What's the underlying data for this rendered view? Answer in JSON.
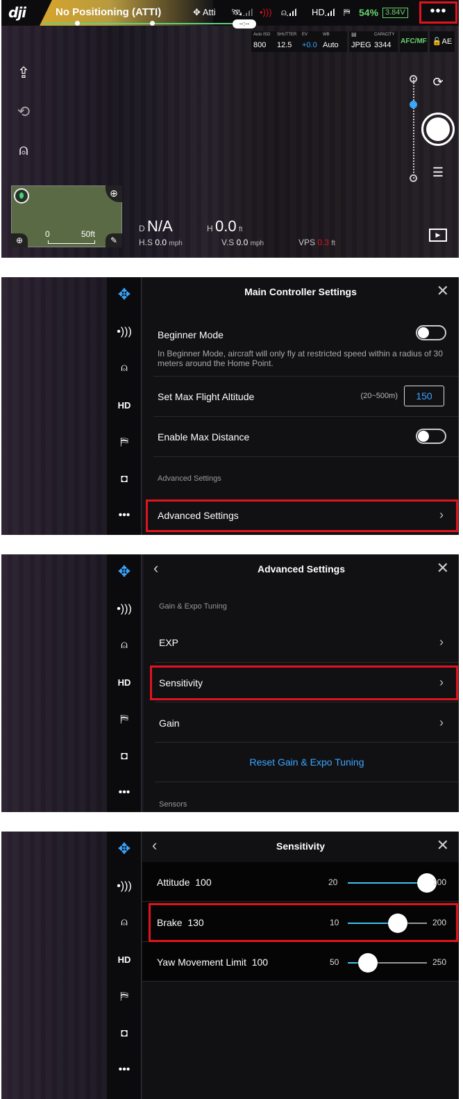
{
  "screen1": {
    "logo": "dji",
    "status": "No Positioning (ATTI)",
    "mode": "Atti",
    "hd_label": "HD",
    "battery_pct": "54%",
    "voltage": "3.84V",
    "time_pill": "--:--",
    "more_label": "•••",
    "camera": [
      {
        "label": "Auto ISO",
        "value": "800"
      },
      {
        "label": "SHUTTER",
        "value": "12.5"
      },
      {
        "label": "EV",
        "value": "+0.0"
      },
      {
        "label": "WB",
        "value": "Auto"
      },
      {
        "label": "",
        "value": "JPEG"
      },
      {
        "label": "CAPACITY",
        "value": "3344"
      }
    ],
    "afc_label": "AFC/MF",
    "ae_label": "AE",
    "map_scale_min": "0",
    "map_scale_max": "50ft",
    "telemetry": {
      "d_label": "D",
      "d_value": "N/A",
      "h_label": "H",
      "h_value": "0.0",
      "h_unit": "ft",
      "hs_label": "H.S",
      "hs_value": "0.0",
      "hs_unit": "mph",
      "vs_label": "V.S",
      "vs_value": "0.0",
      "vs_unit": "mph",
      "vps_label": "VPS",
      "vps_value": "0.3",
      "vps_unit": "ft"
    }
  },
  "sidebar": {
    "hd_label": "HD",
    "more_label": "•••"
  },
  "screen2": {
    "title": "Main Controller Settings",
    "beginner_label": "Beginner Mode",
    "beginner_desc": "In Beginner Mode, aircraft will only fly at restricted speed within a radius of 30 meters around the Home Point.",
    "altitude_label": "Set Max Flight Altitude",
    "altitude_range": "(20~500m)",
    "altitude_value": "150",
    "max_distance_label": "Enable Max Distance",
    "section_label": "Advanced Settings",
    "advanced_label": "Advanced Settings"
  },
  "screen3": {
    "title": "Advanced Settings",
    "section1": "Gain & Expo Tuning",
    "items": [
      "EXP",
      "Sensitivity",
      "Gain"
    ],
    "reset_label": "Reset Gain & Expo Tuning",
    "section2": "Sensors"
  },
  "screen4": {
    "title": "Sensitivity",
    "rows": [
      {
        "label": "Attitude",
        "value": "100",
        "min": "20",
        "max": "100",
        "level": 1.0
      },
      {
        "label": "Brake",
        "value": "130",
        "min": "10",
        "max": "200",
        "level": 0.63
      },
      {
        "label": "Yaw Movement Limit",
        "value": "100",
        "min": "50",
        "max": "250",
        "level": 0.25
      }
    ]
  },
  "colors": {
    "highlight": "#e0141e",
    "accent": "#3aa7ff",
    "battery": "#69d36e",
    "slider": "#3fc4ef"
  }
}
